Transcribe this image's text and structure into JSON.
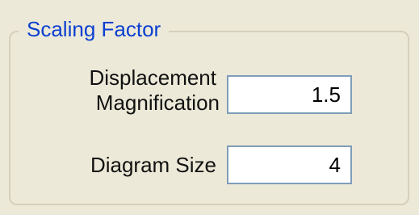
{
  "scaling_factor": {
    "title": "Scaling Factor",
    "displacement_magnification": {
      "label_line1": "Displacement",
      "label_line2": "Magnification",
      "value": "1.5"
    },
    "diagram_size": {
      "label": "Diagram Size",
      "value": "4"
    }
  }
}
